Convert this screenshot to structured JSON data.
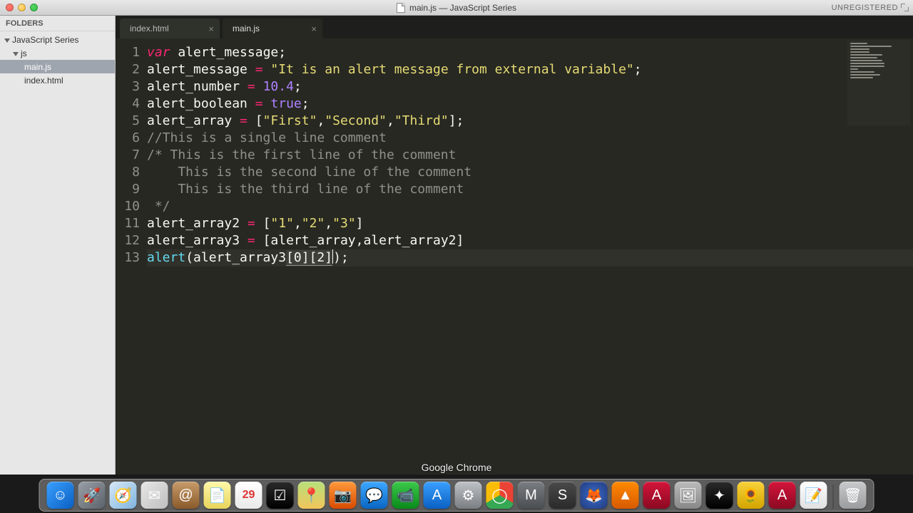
{
  "window": {
    "title": "main.js — JavaScript Series",
    "badge": "UNREGISTERED"
  },
  "sidebar": {
    "heading": "FOLDERS",
    "root": "JavaScript Series",
    "folder": "js",
    "files": [
      "main.js",
      "index.html"
    ],
    "selected": "main.js"
  },
  "tabs": [
    {
      "label": "index.html",
      "active": false
    },
    {
      "label": "main.js",
      "active": true
    }
  ],
  "dock": {
    "hover_label": "Google Chrome",
    "items": [
      {
        "name": "finder",
        "bg": "linear-gradient(135deg,#3aa0ff,#0a60c2)",
        "glyph": "☺"
      },
      {
        "name": "launchpad",
        "bg": "linear-gradient(135deg,#9aa0a8,#5c626a)",
        "glyph": "🚀"
      },
      {
        "name": "safari",
        "bg": "linear-gradient(135deg,#d7e9f7,#7fb4df)",
        "glyph": "🧭"
      },
      {
        "name": "mail",
        "bg": "linear-gradient(135deg,#e7e7e7,#bfbfbf)",
        "glyph": "✉"
      },
      {
        "name": "contacts",
        "bg": "linear-gradient(#c79b6a,#8a5a2a)",
        "glyph": "@"
      },
      {
        "name": "notes",
        "bg": "linear-gradient(#fff8aa,#e8d45a)",
        "glyph": "📄"
      },
      {
        "name": "calendar",
        "bg": "linear-gradient(#fff,#e9e9e9)",
        "glyph": "29"
      },
      {
        "name": "reminders",
        "bg": "linear-gradient(#2a2a2a,#000)",
        "glyph": "☑"
      },
      {
        "name": "maps",
        "bg": "linear-gradient(#b7e07a,#f2c55b)",
        "glyph": "📍"
      },
      {
        "name": "photobooth",
        "bg": "linear-gradient(#ff9a3c,#d94a00)",
        "glyph": "📷"
      },
      {
        "name": "messages",
        "bg": "linear-gradient(#3da8ff,#0a66c2)",
        "glyph": "💬"
      },
      {
        "name": "facetime",
        "bg": "linear-gradient(#3cc94a,#0a8a1a)",
        "glyph": "📹"
      },
      {
        "name": "appstore",
        "bg": "linear-gradient(#3aa0ff,#0a60c2)",
        "glyph": "A"
      },
      {
        "name": "settings",
        "bg": "linear-gradient(#bfc3c7,#7a7e82)",
        "glyph": "⚙"
      },
      {
        "name": "chrome",
        "bg": "conic-gradient(#ea4335 0 120deg,#34a853 120deg 240deg,#fbbc05 240deg 360deg)",
        "glyph": "◯"
      },
      {
        "name": "mamp",
        "bg": "linear-gradient(#7a7e82,#4a4e52)",
        "glyph": "M"
      },
      {
        "name": "sublime",
        "bg": "linear-gradient(#4a4a4a,#2a2a2a)",
        "glyph": "S"
      },
      {
        "name": "firefox",
        "bg": "radial-gradient(circle,#3a6ccf,#223a7a)",
        "glyph": "🦊"
      },
      {
        "name": "vlc",
        "bg": "linear-gradient(#ff8a00,#d85a00)",
        "glyph": "▲"
      },
      {
        "name": "readerA",
        "bg": "linear-gradient(#d4143a,#8a0a22)",
        "glyph": "A"
      },
      {
        "name": "photos",
        "bg": "linear-gradient(#bbb,#888)",
        "glyph": "🖼"
      },
      {
        "name": "imovie",
        "bg": "linear-gradient(#2a2a2a,#000)",
        "glyph": "✦"
      },
      {
        "name": "iphoto",
        "bg": "linear-gradient(#f8d23a,#d4a400)",
        "glyph": "🌻"
      },
      {
        "name": "readerB",
        "bg": "linear-gradient(#d4143a,#8a0a22)",
        "glyph": "A"
      },
      {
        "name": "textedit",
        "bg": "linear-gradient(#fff,#e0e0e0)",
        "glyph": "📝"
      },
      {
        "name": "trash",
        "bg": "linear-gradient(#c8cacc,#9a9c9e)",
        "glyph": "🗑"
      }
    ]
  },
  "code": {
    "current_line": 13,
    "lines": [
      {
        "n": 1,
        "tokens": [
          [
            "kw",
            "var "
          ],
          [
            "id",
            "alert_message"
          ],
          [
            "pu",
            ";"
          ]
        ]
      },
      {
        "n": 2,
        "tokens": [
          [
            "id",
            "alert_message "
          ],
          [
            "op",
            "="
          ],
          [
            "pu",
            " "
          ],
          [
            "str",
            "\"It is an alert message from external variable\""
          ],
          [
            "pu",
            ";"
          ]
        ]
      },
      {
        "n": 3,
        "tokens": [
          [
            "id",
            "alert_number "
          ],
          [
            "op",
            "="
          ],
          [
            "pu",
            " "
          ],
          [
            "num",
            "10.4"
          ],
          [
            "pu",
            ";"
          ]
        ]
      },
      {
        "n": 4,
        "tokens": [
          [
            "id",
            "alert_boolean "
          ],
          [
            "op",
            "="
          ],
          [
            "pu",
            " "
          ],
          [
            "bool",
            "true"
          ],
          [
            "pu",
            ";"
          ]
        ]
      },
      {
        "n": 5,
        "tokens": [
          [
            "id",
            "alert_array "
          ],
          [
            "op",
            "="
          ],
          [
            "pu",
            " ["
          ],
          [
            "str",
            "\"First\""
          ],
          [
            "pu",
            ","
          ],
          [
            "str",
            "\"Second\""
          ],
          [
            "pu",
            ","
          ],
          [
            "str",
            "\"Third\""
          ],
          [
            "pu",
            "];"
          ]
        ]
      },
      {
        "n": 6,
        "tokens": [
          [
            "cm",
            "//This is a single line comment"
          ]
        ]
      },
      {
        "n": 7,
        "tokens": [
          [
            "cm",
            "/* This is the first line of the comment"
          ]
        ]
      },
      {
        "n": 8,
        "tokens": [
          [
            "cm",
            "    This is the second line of the comment"
          ]
        ]
      },
      {
        "n": 9,
        "tokens": [
          [
            "cm",
            "    This is the third line of the comment"
          ]
        ]
      },
      {
        "n": 10,
        "tokens": [
          [
            "cm",
            " */"
          ]
        ]
      },
      {
        "n": 11,
        "tokens": [
          [
            "id",
            "alert_array2 "
          ],
          [
            "op",
            "="
          ],
          [
            "pu",
            " ["
          ],
          [
            "str",
            "\"1\""
          ],
          [
            "pu",
            ","
          ],
          [
            "str",
            "\"2\""
          ],
          [
            "pu",
            ","
          ],
          [
            "str",
            "\"3\""
          ],
          [
            "pu",
            "]"
          ]
        ]
      },
      {
        "n": 12,
        "tokens": [
          [
            "id",
            "alert_array3 "
          ],
          [
            "op",
            "="
          ],
          [
            "pu",
            " [alert_array,alert_array2]"
          ]
        ]
      },
      {
        "n": 13,
        "tokens": [
          [
            "fn",
            "alert"
          ],
          [
            "pu",
            "(alert_array3"
          ],
          [
            "brh",
            "[0]"
          ],
          [
            "brh",
            "[2]"
          ],
          [
            "pu",
            ")"
          ],
          [
            "pu",
            ";"
          ]
        ],
        "cursor_after": 4
      }
    ]
  }
}
